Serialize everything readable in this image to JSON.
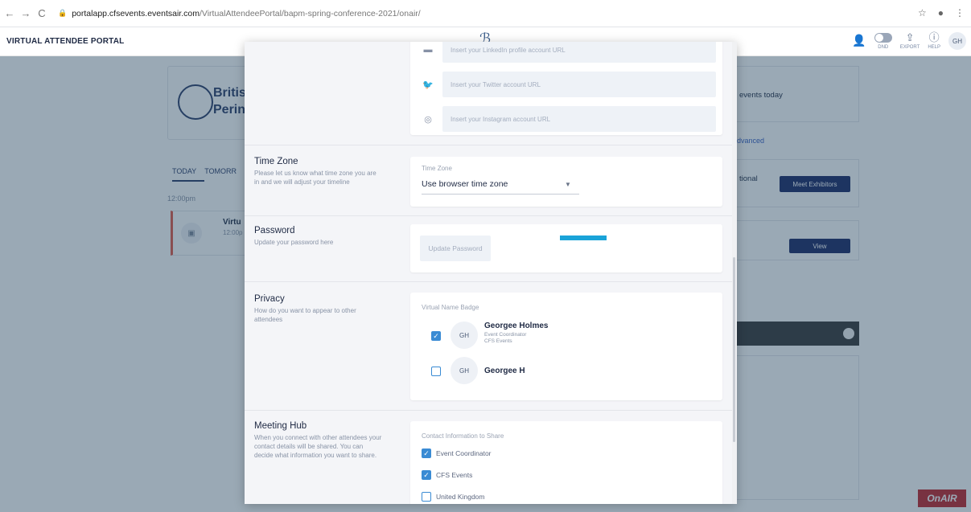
{
  "browser": {
    "back": "←",
    "forward": "→",
    "reload": "C",
    "url_host": "portalapp.cfsevents.eventsair.com",
    "url_path": "/VirtualAttendeePortal/bapm-spring-conference-2021/onair/"
  },
  "header": {
    "title": "VIRTUAL ATTENDEE PORTAL",
    "tools": {
      "dnd": "DND",
      "export": "EXPORT",
      "help": "HELP",
      "avatar": "GH"
    }
  },
  "background": {
    "brand_line1": "Britis",
    "brand_line2": "Perin",
    "tab_today": "TODAY",
    "tab_tomorrow": "TOMORR",
    "time": "12:00pm",
    "session_title": "Virtu",
    "session_time": "12:00p",
    "right_events": "events today",
    "right_advanced": "dvanced",
    "right_national": "tional",
    "meet_exhibitors": "Meet Exhibitors",
    "view": "View",
    "onair_logo": "OnAIR"
  },
  "modal": {
    "social": {
      "linkedin_placeholder": "Insert your LinkedIn profile account URL",
      "twitter_placeholder": "Insert your Twitter account URL",
      "instagram_placeholder": "Insert your Instagram account URL"
    },
    "timezone": {
      "heading": "Time Zone",
      "description": "Please let us know what time zone you are in and we will adjust your timeline",
      "field_label": "Time Zone",
      "value": "Use browser time zone"
    },
    "password": {
      "heading": "Password",
      "description": "Update your password here",
      "button": "Update Password"
    },
    "privacy": {
      "heading": "Privacy",
      "description": "How do you want to appear to other attendees",
      "field_label": "Virtual Name Badge",
      "options": [
        {
          "initials": "GH",
          "name": "Georgee Holmes",
          "role": "Event Coordinator",
          "org": "CFS Events",
          "checked": true
        },
        {
          "initials": "GH",
          "name": "Georgee H",
          "checked": false
        }
      ]
    },
    "meeting_hub": {
      "heading": "Meeting Hub",
      "description": "When you connect with other attendees your contact details will be shared. You can decide what information you want to share.",
      "field_label": "Contact Information to Share",
      "items": [
        {
          "label": "Event Coordinator",
          "checked": true
        },
        {
          "label": "CFS Events",
          "checked": true
        },
        {
          "label": "United Kingdom",
          "checked": false
        }
      ]
    }
  }
}
